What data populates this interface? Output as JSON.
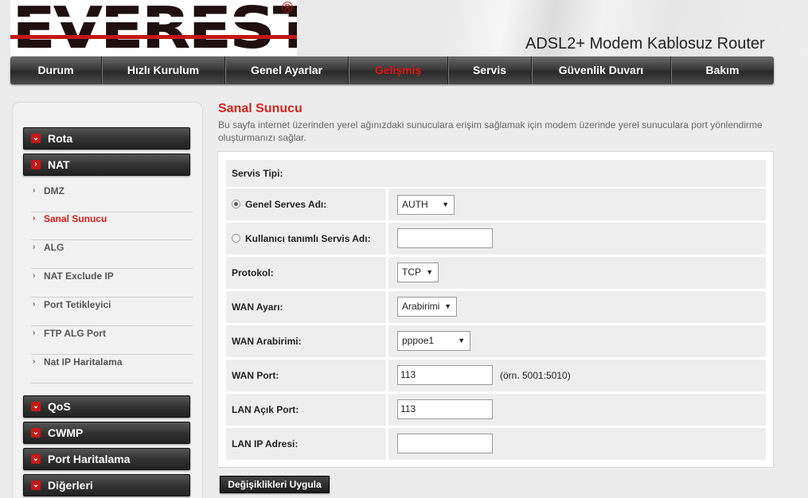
{
  "header": {
    "logo_text": "EVEREST",
    "logo_mark": "®",
    "product_title": "ADSL2+ Modem Kablosuz Router"
  },
  "nav": {
    "items": [
      {
        "label": "Durum"
      },
      {
        "label": "Hızlı Kurulum"
      },
      {
        "label": "Genel Ayarlar"
      },
      {
        "label": "Gelişmiş",
        "active": true
      },
      {
        "label": "Servis"
      },
      {
        "label": "Güvenlik Duvarı"
      },
      {
        "label": "Bakım"
      }
    ]
  },
  "sidebar": {
    "groups_top": [
      {
        "label": "Rota",
        "icon": "chevron-down-icon"
      },
      {
        "label": "NAT",
        "icon": "chevron-right-icon"
      }
    ],
    "nat_items": [
      {
        "label": "DMZ"
      },
      {
        "label": "Sanal Sunucu",
        "active": true
      },
      {
        "label": "ALG"
      },
      {
        "label": "NAT Exclude IP"
      },
      {
        "label": "Port Tetikleyici"
      },
      {
        "label": "FTP ALG Port"
      },
      {
        "label": "Nat IP Haritalama"
      }
    ],
    "groups_bottom": [
      {
        "label": "QoS",
        "icon": "chevron-down-icon"
      },
      {
        "label": "CWMP",
        "icon": "chevron-down-icon"
      },
      {
        "label": "Port Haritalama",
        "icon": "chevron-down-icon"
      },
      {
        "label": "Diğerleri",
        "icon": "chevron-down-icon"
      }
    ]
  },
  "main": {
    "title": "Sanal Sunucu",
    "description": "Bu sayfa internet üzerinden yerel ağınızdaki sunuculara erişim sağlamak için modem üzerinde yerel sunuculara port yönlendirme oluşturmanızı sağlar."
  },
  "form": {
    "service_type_label": "Servis Tipi:",
    "generic_service_label": "Genel Serves Adı:",
    "generic_service_value": "AUTH",
    "custom_service_label": "Kullanıcı tanımlı Servis Adı:",
    "custom_service_value": "",
    "protocol_label": "Protokol:",
    "protocol_value": "TCP",
    "wan_setting_label": "WAN Ayarı:",
    "wan_setting_value": "Arabirimi",
    "wan_interface_label": "WAN Arabirimi:",
    "wan_interface_value": "pppoe1",
    "wan_port_label": "WAN Port:",
    "wan_port_value": "113",
    "wan_port_hint": "(örn. 5001:5010)",
    "lan_port_label": "LAN Açık Port:",
    "lan_port_value": "113",
    "lan_ip_label": "LAN IP Adresi:",
    "lan_ip_value": "",
    "apply_label": "Değişiklikleri Uygula"
  },
  "colors": {
    "accent_red": "#d0271e",
    "nav_dark": "#2a2a2a"
  }
}
